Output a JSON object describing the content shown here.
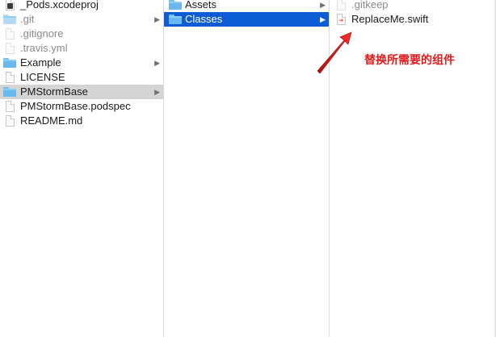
{
  "column1": {
    "items": [
      {
        "label": "_Pods.xcodeproj",
        "icon": "xcodeproj-file-icon"
      },
      {
        "label": ".git",
        "icon": "folder-icon"
      },
      {
        "label": ".gitignore",
        "icon": "document-icon"
      },
      {
        "label": ".travis.yml",
        "icon": "document-icon"
      },
      {
        "label": "Example",
        "icon": "folder-icon"
      },
      {
        "label": "LICENSE",
        "icon": "document-icon"
      },
      {
        "label": "PMStormBase",
        "icon": "folder-icon"
      },
      {
        "label": "PMStormBase.podspec",
        "icon": "document-icon"
      },
      {
        "label": "README.md",
        "icon": "document-icon"
      }
    ]
  },
  "column2": {
    "items": [
      {
        "label": "Assets",
        "icon": "folder-icon"
      },
      {
        "label": "Classes",
        "icon": "folder-icon"
      }
    ]
  },
  "column3": {
    "items": [
      {
        "label": ".gitkeep",
        "icon": "document-icon"
      },
      {
        "label": "ReplaceMe.swift",
        "icon": "swift-file-icon"
      }
    ]
  },
  "annotation": {
    "text": "替换所需要的组件",
    "color": "#e11b1b"
  },
  "colors": {
    "selection_active": "#0b5cd5",
    "selection_inactive": "#d4d4d4",
    "folder": "#68b8ef"
  },
  "disclosure_glyph": "▶"
}
